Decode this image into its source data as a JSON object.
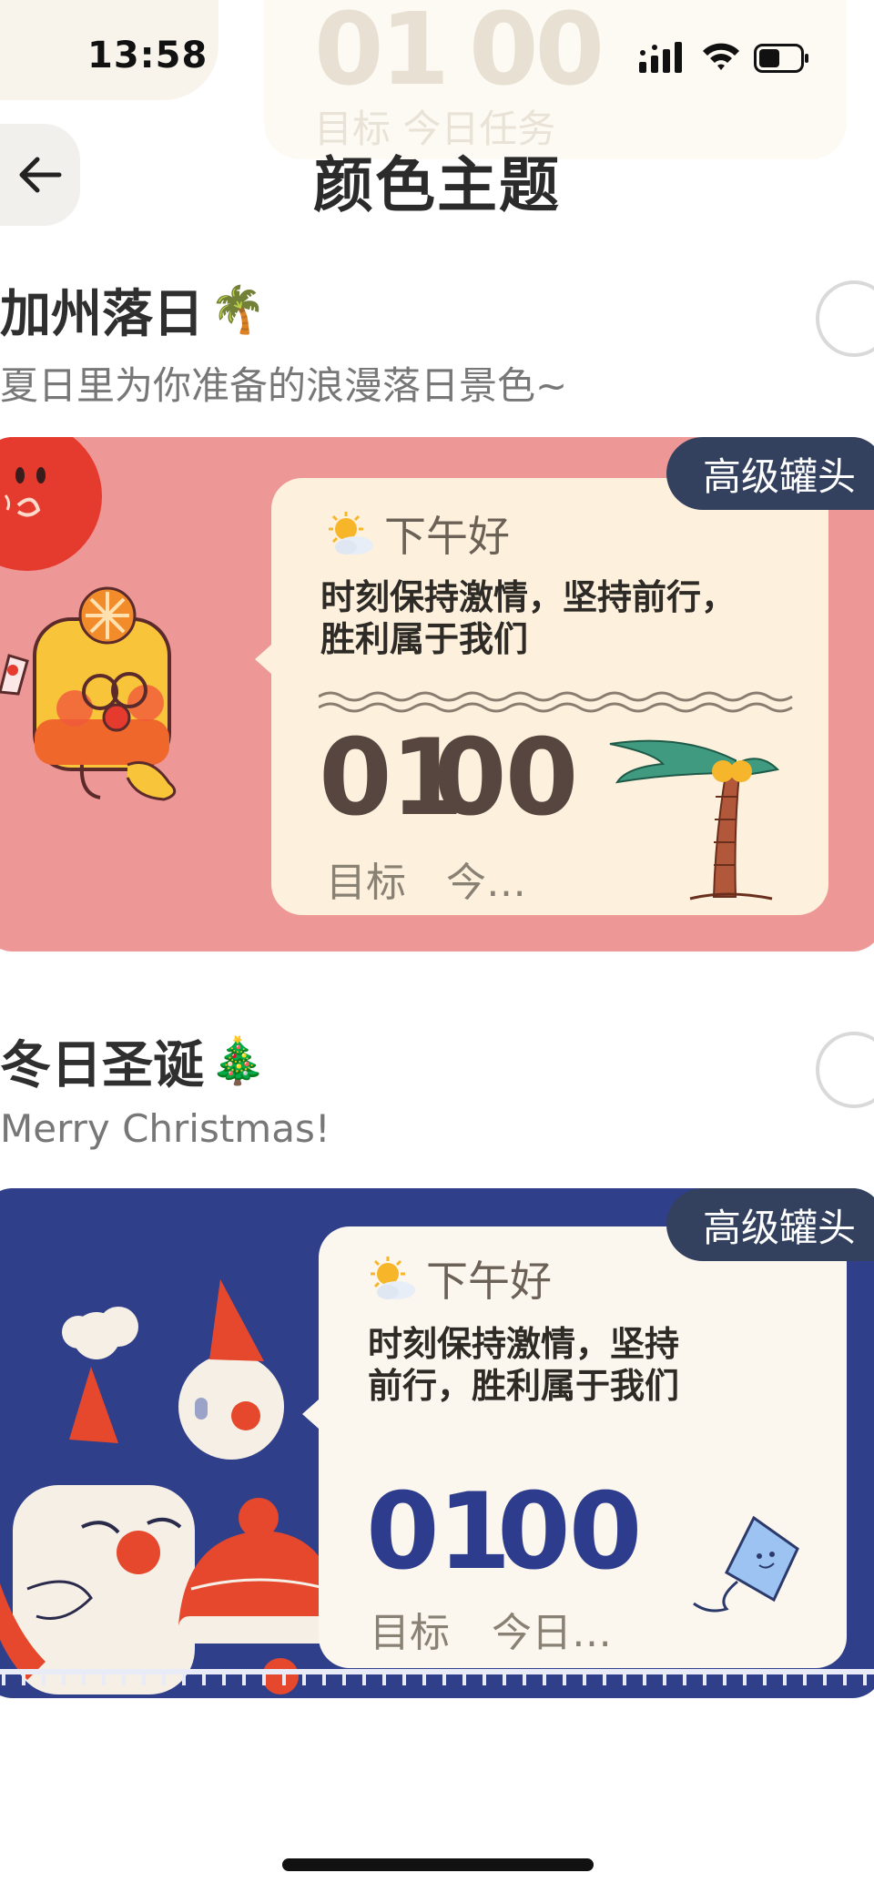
{
  "status_bar": {
    "time": "13:58"
  },
  "header": {
    "title": "颜色主题"
  },
  "background_widget": {
    "num_left": "01",
    "num_right": "00",
    "label": "目标 今日任务"
  },
  "themes": [
    {
      "title": "加州落日",
      "emoji": "🌴",
      "subtitle": "夏日里为你准备的浪漫落日景色~",
      "badge": "高级罐头",
      "greeting": "下午好",
      "motto_line1": "时刻保持激情，坚持前行，",
      "motto_line2": "胜利属于我们",
      "num_left": "01",
      "num_right": "00",
      "label_goal": "目标",
      "label_today": "今…",
      "colors": {
        "card_bg": "#ee9797",
        "number": "#5a4a40"
      }
    },
    {
      "title": "冬日圣诞",
      "emoji": "🎄",
      "subtitle": "Merry Christmas!",
      "badge": "高级罐头",
      "greeting": "下午好",
      "motto_line1": "时刻保持激情，坚持",
      "motto_line2": "前行，胜利属于我们",
      "num_left": "01",
      "num_right": "00",
      "label_goal": "目标",
      "label_today": "今日…",
      "colors": {
        "card_bg": "#2f3f8a",
        "number": "#2d3c8c"
      }
    }
  ],
  "icons": [
    "back-arrow-icon",
    "signal-icon",
    "wifi-icon",
    "battery-icon",
    "sun-cloud-icon",
    "palm-tree-icon",
    "kite-icon"
  ]
}
